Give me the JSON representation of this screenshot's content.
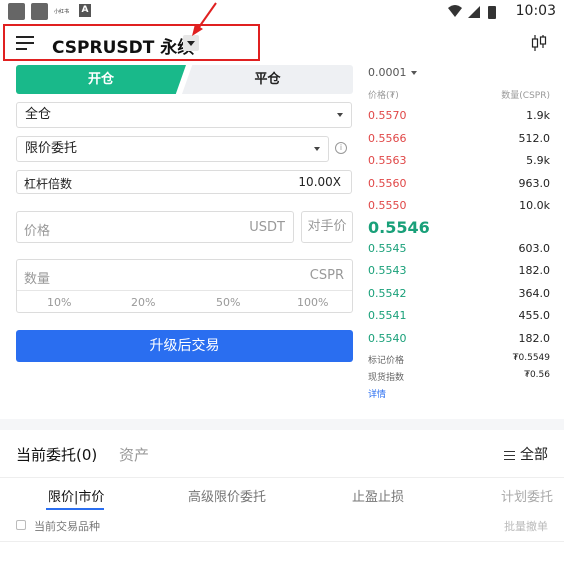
{
  "status_bar": {
    "small_text": "小红书",
    "time": "10:03",
    "a_label": "A"
  },
  "header": {
    "title": "CSPRUSDT 永续"
  },
  "trade": {
    "tab_open": "开仓",
    "tab_close": "平仓",
    "margin_mode": "全仓",
    "order_type": "限价委托",
    "leverage_label": "杠杆倍数",
    "leverage_value": "10.00X",
    "price_placeholder": "价格",
    "price_unit": "USDT",
    "counter_price": "对手价",
    "qty_placeholder": "数量",
    "qty_unit": "CSPR",
    "percents": [
      "10%",
      "20%",
      "50%",
      "100%"
    ],
    "upgrade_button": "升级后交易"
  },
  "orderbook": {
    "precision": "0.0001",
    "header_price": "价格(₮)",
    "header_qty": "数量(CSPR)",
    "asks": [
      {
        "price": "0.5570",
        "qty": "1.9k"
      },
      {
        "price": "0.5566",
        "qty": "512.0"
      },
      {
        "price": "0.5563",
        "qty": "5.9k"
      },
      {
        "price": "0.5560",
        "qty": "963.0"
      },
      {
        "price": "0.5550",
        "qty": "10.0k"
      }
    ],
    "last_price": "0.5546",
    "bids": [
      {
        "price": "0.5545",
        "qty": "603.0"
      },
      {
        "price": "0.5543",
        "qty": "182.0"
      },
      {
        "price": "0.5542",
        "qty": "364.0"
      },
      {
        "price": "0.5541",
        "qty": "455.0"
      },
      {
        "price": "0.5540",
        "qty": "182.0"
      }
    ],
    "mark_price_label": "标记价格",
    "mark_price_value": "₮0.5549",
    "index_label": "现货指数",
    "index_value": "₮0.56",
    "detail": "详情"
  },
  "orders": {
    "title": "当前委托(0)",
    "assets": "资产",
    "all": "全部",
    "subtabs": [
      "限价|市价",
      "高级限价委托",
      "止盈止损",
      "计划委托"
    ],
    "current_symbol_only": "当前交易品种",
    "batch_cancel": "批量撤单"
  },
  "colors": {
    "green": "#19b98a",
    "red": "#e04747",
    "blue": "#2a6ef0",
    "highlight": "#e02020"
  }
}
